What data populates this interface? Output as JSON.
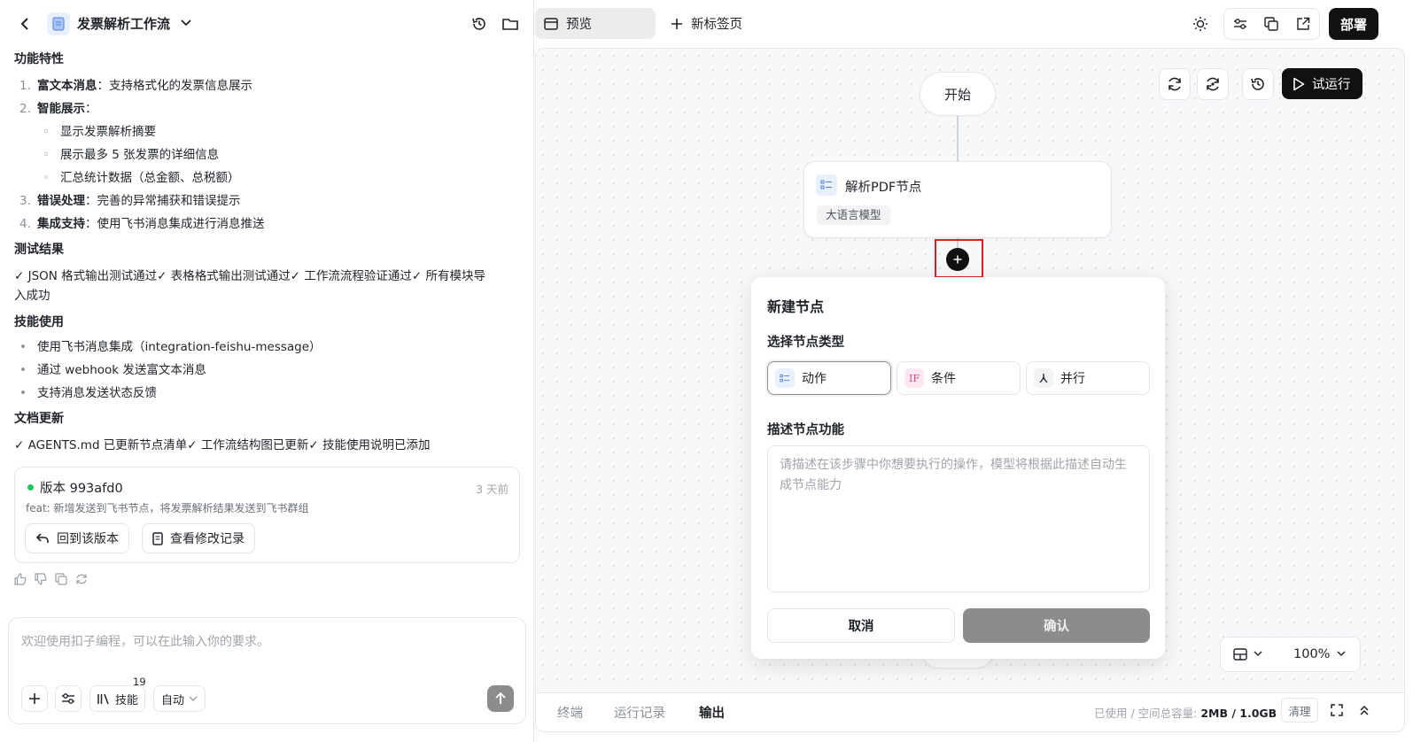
{
  "header": {
    "title": "发票解析工作流",
    "tab_preview": "预览",
    "tab_new": "新标签页",
    "deploy": "部署"
  },
  "chat": {
    "features_heading": "功能特性",
    "features": [
      {
        "num": "1.",
        "bold": "富文本消息",
        "text": "：支持格式化的发票信息展示"
      },
      {
        "num": "2.",
        "bold": "智能展示",
        "text": "："
      },
      {
        "num": "3.",
        "bold": "错误处理",
        "text": "：完善的异常捕获和错误提示"
      },
      {
        "num": "4.",
        "bold": "集成支持",
        "text": "：使用飞书消息集成进行消息推送"
      }
    ],
    "sub_items": [
      "显示发票解析摘要",
      "展示最多 5 张发票的详细信息",
      "汇总统计数据（总金额、总税额）"
    ],
    "test_heading": "测试结果",
    "test_line1": "✓ JSON 格式输出测试通过✓ 表格格式输出测试通过✓ 工作流流程验证通过✓ 所有模块导",
    "test_line2": "入成功",
    "skills_heading": "技能使用",
    "skills": [
      "使用飞书消息集成（integration-feishu-message）",
      "通过 webhook 发送富文本消息",
      "支持消息发送状态反馈"
    ],
    "docs_heading": "文档更新",
    "docs_line": "✓ AGENTS.md 已更新节点清单✓ 工作流结构图已更新✓ 技能使用说明已添加",
    "version": {
      "label": "版本 993afd0",
      "time": "3 天前",
      "desc": "feat: 新增发送到飞书节点，将发票解析结果发送到飞书群组",
      "revert_btn": "回到该版本",
      "log_btn": "查看修改记录"
    }
  },
  "composer": {
    "placeholder": "欢迎使用扣子编程，可以在此输入你的要求。",
    "skills_label": "技能",
    "skills_count": "19",
    "mode": "自动"
  },
  "canvas": {
    "run_btn": "试运行",
    "start_node": "开始",
    "pdf_node": {
      "title": "解析PDF节点",
      "tag": "大语言模型"
    },
    "zoom": "100%"
  },
  "dialog": {
    "title": "新建节点",
    "type_label": "选择节点类型",
    "types": [
      {
        "label": "动作",
        "icon": "list-icon"
      },
      {
        "label": "条件",
        "icon": "if-icon"
      },
      {
        "label": "并行",
        "icon": "branch-icon"
      }
    ],
    "desc_label": "描述节点功能",
    "desc_placeholder": "请描述在该步骤中你想要执行的操作，模型将根据此描述自动生成节点能力",
    "cancel": "取消",
    "confirm": "确认"
  },
  "bottom": {
    "tabs": [
      "终端",
      "运行记录",
      "输出"
    ],
    "storage_label": "已使用 / 空间总容量: ",
    "storage_value": "2MB / 1.0GB",
    "clear": "清理"
  },
  "colors": {
    "accent": "#1f2329",
    "highlight": "#e02020",
    "confirm_disabled": "#8c8c8c",
    "status_green": "#22c55e"
  }
}
